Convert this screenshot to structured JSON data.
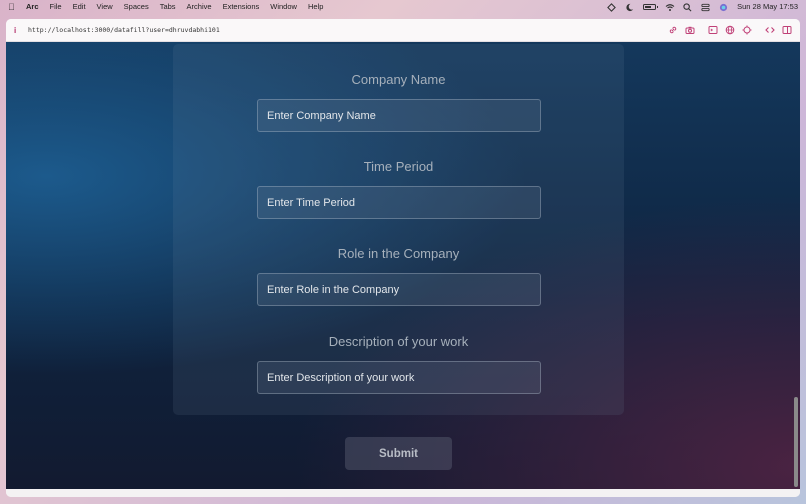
{
  "menubar": {
    "app": "Arc",
    "items": [
      "File",
      "Edit",
      "View",
      "Spaces",
      "Tabs",
      "Archive",
      "Extensions",
      "Window",
      "Help"
    ],
    "datetime": "Sun 28 May  17:53"
  },
  "browser": {
    "url": "http://localhost:3000/datafill?user=dhruvdabhi101",
    "toolbar_icons": [
      "link-icon",
      "camera-icon",
      "terminal-icon",
      "globe-icon",
      "target-icon",
      "code-icon",
      "split-view-icon"
    ]
  },
  "form": {
    "fields": [
      {
        "label": "Company Name",
        "placeholder": "Enter Company Name"
      },
      {
        "label": "Time Period",
        "placeholder": "Enter Time Period"
      },
      {
        "label": "Role in the Company",
        "placeholder": "Enter Role in the Company"
      },
      {
        "label": "Description of your work",
        "placeholder": "Enter Description of your work"
      }
    ],
    "submit_label": "Submit"
  },
  "colors": {
    "accent": "#c04077",
    "background_top": "#14385c",
    "background_bottom": "#121a30"
  }
}
